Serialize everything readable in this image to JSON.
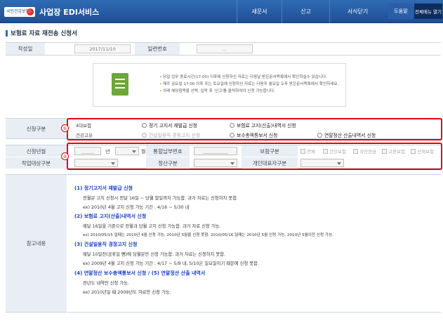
{
  "header": {
    "logo_text": "국민건강보험",
    "title": "사업장 EDI서비스",
    "nav": [
      "새문서",
      "신고",
      "서식닫기"
    ],
    "help": "도움말",
    "open_menu": "전체메뉴 열기"
  },
  "page_title": "보험료 자료 재전송 신청서",
  "writing": {
    "date_label": "작성일",
    "date_value": "2017/11/10",
    "serial_label": "일련번호",
    "serial_value": "..."
  },
  "notice": [
    "당일 업무 종료시간(17:00) 이후에 신청하신 자료는 다음날 받은문서목록에서 확인하실수 있습니다.",
    "매주 금요일 17:00 이후 또는 토요일에 신청하신 자료는 다음주 월요일 오후 받은문서목록에서 확인하세요.",
    "아래 해당항목을 선택, 입력 후 '신고'를 클릭하여야 신청 가능합니다."
  ],
  "apply_type": {
    "label": "신청구분",
    "marker": "①",
    "group1": "4대보험",
    "group2": "건강고유",
    "options": [
      {
        "label": "정기 고지서 재발급 신청",
        "disabled": false
      },
      {
        "label": "보험료 고지(산출)내역서 신청",
        "disabled": false
      },
      {
        "label": "건설일용직 경정고지 신청",
        "disabled": true
      },
      {
        "label": "보수총액통보서 신청",
        "disabled": false
      },
      {
        "label": "연말정산 산출내역서 신청",
        "disabled": false
      }
    ]
  },
  "apply_detail": {
    "marker": "②",
    "year_month_label": "신청년월",
    "year_placeholder": "______",
    "year_unit": "년",
    "month_unit": "월",
    "integrated_label": "통합납부번호",
    "integrated_placeholder": "____________",
    "insurance_label": "보험구분",
    "insurance_options": [
      "전체",
      "건강보험",
      "국민연금",
      "고용보험",
      "산재보험"
    ],
    "target_label": "작업대상구분",
    "settle_label": "정산구분",
    "personal_label": "개인대표자구분"
  },
  "reference": {
    "label": "참고내용",
    "sections": [
      {
        "title": "(1) 정기고지서 재발급 신청",
        "lines": [
          "전월분 고지 신청시 전달 16일 ~ 당월 말일까지 가능함. 과거 자료는 신청하지 못함.",
          "ex) 2010년 4월 고지 신청 가능 기간 : 4/16 ~ 5/30 내"
        ]
      },
      {
        "title": "(2) 보험료 고지(산출)내역서 신청",
        "lines": [
          "매달 16일을 기준으로 전월과 당월 고지 신청 가능함. 과거 자료 신청 가능.",
          "ex) 2010/05/15 일때는 2010년 4월 신청 가능, 2010년 5월을 신청 못함. 2010/05/16 일때는 2010년 5월 신청 가능, 2010년 5월이전 신청 가능."
        ]
      },
      {
        "title": "(3) 건설일용직 경정고지 신청",
        "lines": [
          "매달 10일전(공휴일 뺌)에 당월분만 신청 가능함. 과거 자료는 신청하지 못함.",
          "ex) 2009년 4월 고지 신청 가능 기간 : 4/17 ~ 5/9 내, 5/10은 일요일이기 때문에 신청 못함."
        ]
      },
      {
        "title": "(4) 연말정산 보수총액통보서 신청 / (5) 연말정산 산출 내역서",
        "lines": [
          "전년도 내역만 신청 가능.",
          "ex) 2010년일 때 2009년도 자료만 신청 가능."
        ]
      }
    ]
  }
}
